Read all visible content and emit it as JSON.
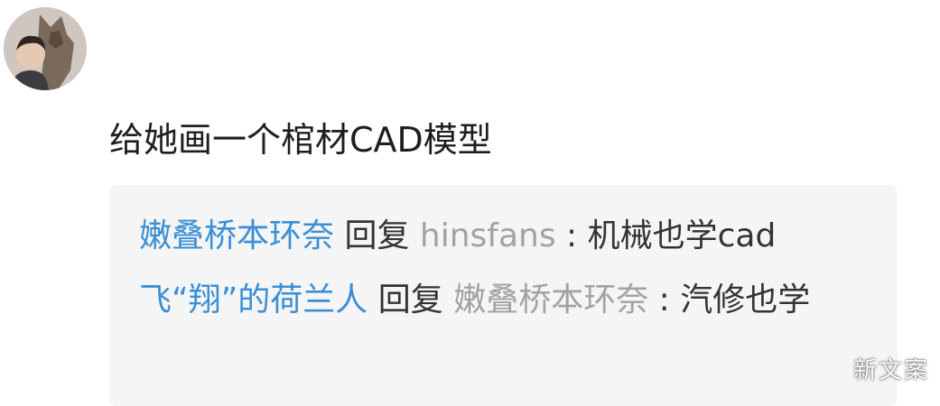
{
  "comment": {
    "text": "给她画一个棺材CAD模型"
  },
  "replies": [
    {
      "author": "嫩叠桥本环奈",
      "action": " 回复 ",
      "target": "hinsfans",
      "separator": " : ",
      "message": "机械也学cad"
    },
    {
      "author": "飞“翔”的荷兰人",
      "action": " 回复 ",
      "target": "嫩叠桥本环奈",
      "separator": " : ",
      "message": "汽修也学"
    }
  ],
  "watermark": "新文案",
  "colors": {
    "username": "#3a8fd6",
    "target": "#a2a2a6",
    "text": "#333333",
    "reply_background": "#f5f5f6"
  }
}
